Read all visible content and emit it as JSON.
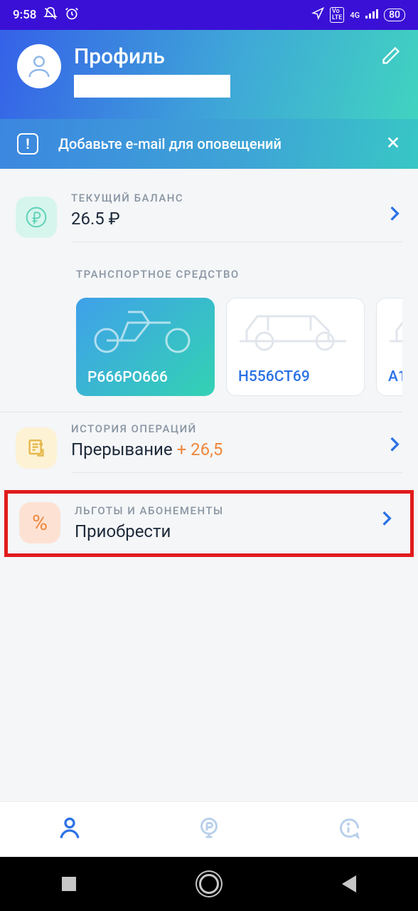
{
  "status": {
    "time": "9:58",
    "battery": "80"
  },
  "header": {
    "title": "Профиль"
  },
  "alert": {
    "text": "Добавьте e-mail для оповещений"
  },
  "balance": {
    "label": "ТЕКУЩИЙ БАЛАНС",
    "value": "26.5 ₽"
  },
  "vehicles": {
    "label": "ТРАНСПОРТНОЕ СРЕДСТВО",
    "items": [
      {
        "plate": "Р666РО666",
        "type": "motorcycle",
        "active": true
      },
      {
        "plate": "Н556СТ69",
        "type": "car",
        "active": false
      },
      {
        "plate": "А1",
        "type": "car",
        "active": false
      }
    ]
  },
  "history": {
    "label": "ИСТОРИЯ ОПЕРАЦИЙ",
    "value": "Прерывание ",
    "delta": "+ 26,5"
  },
  "benefits": {
    "label": "ЛЬГОТЫ И АБОНЕМЕНТЫ",
    "value": "Приобрести"
  }
}
